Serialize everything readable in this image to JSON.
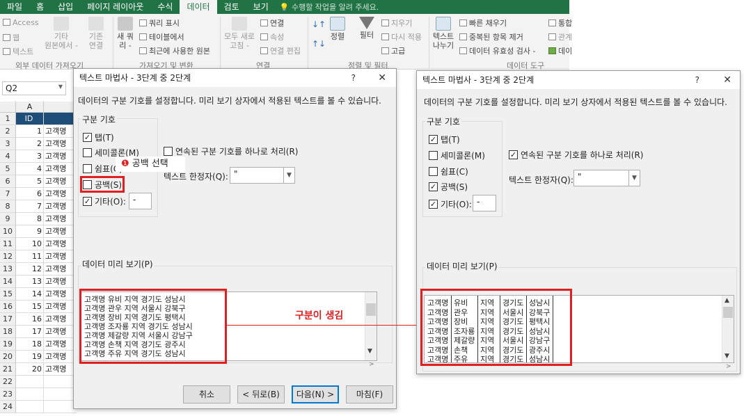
{
  "ribbon": {
    "tabs": [
      "파일",
      "홈",
      "삽입",
      "페이지 레이아웃",
      "수식",
      "데이터",
      "검토",
      "보기"
    ],
    "active_tab": "데이터",
    "tell_me_placeholder": "수행할 작업을 알려 주세요.",
    "external": {
      "access": "Access",
      "web": "웹",
      "text": "텍스트",
      "other": "기타",
      "other2": "원본에서 -",
      "existing": "기존",
      "existing2": "연결",
      "group": "외부 데이터 가져오기"
    },
    "get": {
      "new": "새 쿼",
      "new2": "리 -",
      "show_query": "쿼리 표시",
      "from_table": "테이블에서",
      "recent": "최근에 사용한 원본",
      "group": "가져오기 및 변환"
    },
    "conn": {
      "refresh": "모두 새로",
      "refresh2": "고침 -",
      "connections": "연결",
      "properties": "속성",
      "edit_links": "연결 편집",
      "group": "연결"
    },
    "sort": {
      "sort": "정렬",
      "filter": "필터",
      "clear": "지우기",
      "reapply": "다시 적용",
      "advanced": "고급",
      "group": "정렬 및 필터"
    },
    "tools": {
      "text_to_col": "텍스트",
      "text_to_col2": "나누기",
      "flash_fill": "빠른 채우기",
      "remove_dup": "중복된 항목 제거",
      "validation": "데이터 유효성 검사 -",
      "group": "데이터 도구",
      "consolidate": "통합",
      "relations": "관계",
      "data_model": "데이"
    }
  },
  "namebox": "Q2",
  "sheet": {
    "col_a": "A",
    "header_id": "ID",
    "rows": [
      "1",
      "2",
      "3",
      "4",
      "5",
      "6",
      "7",
      "8",
      "9",
      "10",
      "11",
      "12",
      "13",
      "14",
      "15",
      "16",
      "17",
      "18",
      "19",
      "20",
      "21",
      "22",
      "23",
      "24"
    ],
    "ids": [
      "1",
      "2",
      "3",
      "4",
      "5",
      "6",
      "7",
      "8",
      "9",
      "10",
      "11",
      "12",
      "13",
      "14",
      "15",
      "16",
      "17",
      "18",
      "19",
      "20"
    ],
    "name_cell": "고객명"
  },
  "dialog": {
    "title": "텍스트 마법사 - 3단계 중 2단계",
    "help": "?",
    "close": "✕",
    "description": "데이터의 구분 기호를 설정합니다. 미리 보기 상자에서 적용된 텍스트를 볼 수 있습니다.",
    "delims_label": "구분 기호",
    "tab": "탭(T)",
    "semicolon": "세미콜론(M)",
    "comma": "쉼표(C)",
    "space": "공백(S)",
    "other": "기타(O):",
    "other_value": "-",
    "consecutive": "연속된 구분 기호를 하나로 처리(R)",
    "qualifier_label": "텍스트 한정자(Q):",
    "qualifier_value": "\"",
    "preview_label": "데이터 미리 보기(P)",
    "buttons": {
      "cancel": "취소",
      "back": "< 뒤로(B)",
      "next": "다음(N) >",
      "finish": "마침(F)"
    }
  },
  "preview_lines": [
    [
      "고객명",
      "유비",
      "지역",
      "경기도",
      "성남시"
    ],
    [
      "고객명",
      "관우",
      "지역",
      "서울시",
      "강북구"
    ],
    [
      "고객명",
      "장비",
      "지역",
      "경기도",
      "평택시"
    ],
    [
      "고객명",
      "조자룡",
      "지역",
      "경기도",
      "성남시"
    ],
    [
      "고객명",
      "제갈량",
      "지역",
      "서울시",
      "강남구"
    ],
    [
      "고객명",
      "손책",
      "지역",
      "경기도",
      "광주시"
    ],
    [
      "고객명",
      "주유",
      "지역",
      "경기도",
      "성남시"
    ]
  ],
  "annotations": {
    "step_marker": "❶",
    "step_text": "공백 선택",
    "result_text": "구분이 생김"
  },
  "colors": {
    "excel_green": "#217346",
    "annotation_red": "#e02020",
    "focus_blue": "#0078d7"
  }
}
